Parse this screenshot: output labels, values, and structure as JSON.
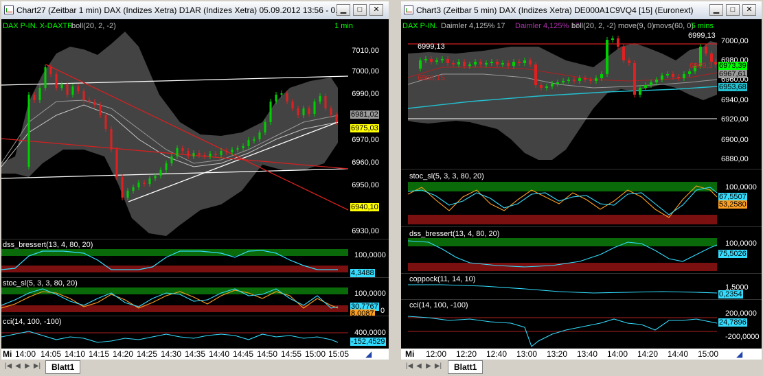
{
  "left": {
    "title": "Chart27 (Zeitbar 1 min)  DAX (Indizes Xetra) D1AR (Indizes Xetra) 05.09.2012 13:56 - 0...",
    "legend_main": "DAX P-IN. X-DAXTR",
    "legend_main2": "boll(20, 2, -2)",
    "interval": "1 min",
    "yticks": [
      "7010,00",
      "7000,00",
      "6990,00",
      "6980,00",
      "6970,00",
      "6960,00",
      "6950,00",
      "6940,00",
      "6930,00"
    ],
    "tags": [
      "6981,02",
      "6975,03",
      "6940,10"
    ],
    "ind1": {
      "name": "dss_bressert(13, 4, 80, 20)",
      "top": "100,0000",
      "value": "4,3488"
    },
    "ind2": {
      "name": "stoc_sl(5, 3, 3, 80, 20)",
      "top": "100,0000",
      "value": "30,7767",
      "bottom": "0",
      "value2": "8,0087"
    },
    "ind3": {
      "name": "cci(14, 100, -100)",
      "top": "400,0000",
      "value": "-152,4529"
    },
    "xaxis_corner": "Mi",
    "xaxis": [
      "14:00",
      "14:05",
      "14:10",
      "14:15",
      "14:20",
      "14:25",
      "14:30",
      "14:35",
      "14:40",
      "14:45",
      "14:50",
      "14:55",
      "15:00",
      "15:05"
    ],
    "sheet_tab": "Blatt1"
  },
  "right": {
    "title": "Chart3 (Zeitbar 5 min)  DAX (Indizes Xetra) DE000A1C9VQ4 [15] (Euronext)",
    "legend_main": "DAX P-IN.",
    "legend_main_b": "Daimler  4,125% 17",
    "legend_main_c": "Daimler  4,125% 17",
    "legend_main_d": "boll(20, 2, -2)",
    "legend_main_e": "move(9, 0)",
    "legend_main_f": "movs(60, 0)",
    "interval": "5 mins",
    "yticks": [
      "7000,00",
      "6980,00",
      "6960,00",
      "6940,00",
      "6920,00",
      "6900,00",
      "6880,00"
    ],
    "annot_high": "6999,13",
    "annot_high2": "6999,13",
    "annot_low": "6968,15",
    "annot_mid": "6969,3",
    "tags": [
      "6973,39",
      "6967,61",
      "6953,68"
    ],
    "ind1": {
      "name": "stoc_sl(5, 3, 3, 80, 20)",
      "top": "100,0000",
      "value": "67,5507",
      "value2": "53,2580"
    },
    "ind2": {
      "name": "dss_bressert(13, 4, 80, 20)",
      "top": "100,0000",
      "value": "75,5026"
    },
    "ind3": {
      "name": "coppock(11, 14, 10)",
      "top": "1,5000",
      "value": "0,2354"
    },
    "ind4": {
      "name": "cci(14, 100, -100)",
      "top": "200,0000",
      "value": "24,7896",
      "bottom": "-200,0000"
    },
    "xaxis_corner": "Mi",
    "xaxis": [
      "12:00",
      "12:20",
      "12:40",
      "13:00",
      "13:20",
      "13:40",
      "14:00",
      "14:20",
      "14:40",
      "15:00"
    ],
    "sheet_tab": "Blatt1"
  }
}
